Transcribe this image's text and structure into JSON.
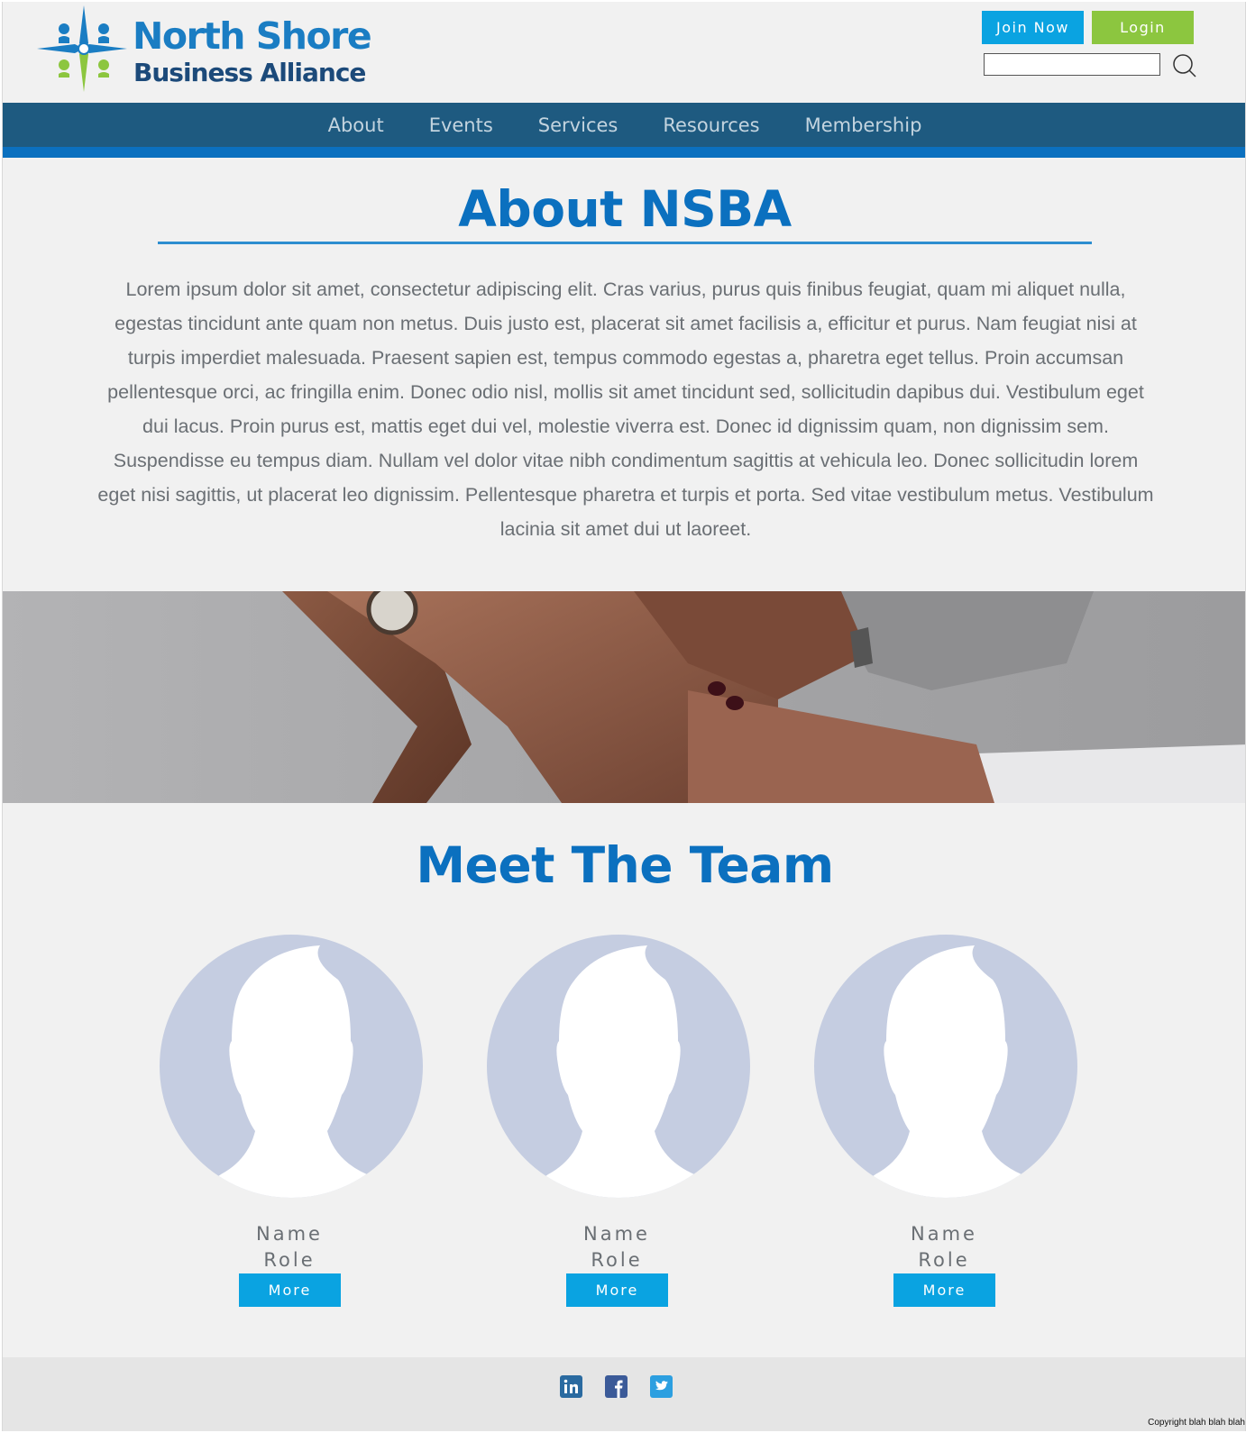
{
  "brand": {
    "name_line1": "North Shore",
    "name_line2": "Business Alliance",
    "icon": "compass-star-logo",
    "colors": {
      "blue": "#1a7dc3",
      "navy": "#1c4a7a",
      "green": "#8cc63f"
    }
  },
  "header": {
    "join_label": "Join Now",
    "login_label": "Login",
    "search_placeholder": "",
    "search_icon": "search-icon"
  },
  "nav": {
    "items": [
      {
        "label": "About",
        "active": true
      },
      {
        "label": "Events",
        "active": false
      },
      {
        "label": "Services",
        "active": false
      },
      {
        "label": "Resources",
        "active": false
      },
      {
        "label": "Membership",
        "active": false
      }
    ],
    "colors": {
      "bar": "#1e5a80",
      "underline": "#0b70bf",
      "active_indicator": "#0aa3e1"
    }
  },
  "about": {
    "title": "About NSBA",
    "body": "Lorem ipsum dolor sit amet, consectetur adipiscing elit. Cras varius, purus quis finibus feugiat, quam mi aliquet nulla, egestas tincidunt ante quam non metus. Duis justo est, placerat sit amet facilisis a, efficitur et purus. Nam feugiat nisi at turpis imperdiet malesuada. Praesent sapien est, tempus commodo egestas a, pharetra eget tellus. Proin accumsan pellentesque orci, ac fringilla enim. Donec odio nisl, mollis sit amet tincidunt sed, sollicitudin dapibus dui. Vestibulum eget dui lacus. Proin purus est, mattis eget dui vel, molestie viverra est. Donec id dignissim quam, non dignissim sem. Suspendisse eu tempus diam. Nullam vel dolor vitae nibh condimentum sagittis at vehicula leo. Donec sollicitudin lorem eget nisi sagittis, ut placerat leo dignissim. Pellentesque pharetra et turpis et porta. Sed vitae vestibulum metus. Vestibulum lacinia sit amet dui ut laoreet."
  },
  "banner": {
    "image": "stacked-hands-photo"
  },
  "team": {
    "title": "Meet The Team",
    "members": [
      {
        "name": "Name",
        "role": "Role",
        "button": "More",
        "avatar": "person-silhouette-icon"
      },
      {
        "name": "Name",
        "role": "Role",
        "button": "More",
        "avatar": "person-silhouette-icon"
      },
      {
        "name": "Name",
        "role": "Role",
        "button": "More",
        "avatar": "person-silhouette-icon"
      }
    ]
  },
  "footer": {
    "social": [
      "linkedin-icon",
      "facebook-icon",
      "twitter-icon"
    ],
    "copyright": "Copyright blah blah blah"
  },
  "colors": {
    "accent": "#0aa3e1",
    "heading": "#0b70bf",
    "text": "#6a6f74",
    "background": "#f1f1f1",
    "login": "#8cc63f"
  }
}
